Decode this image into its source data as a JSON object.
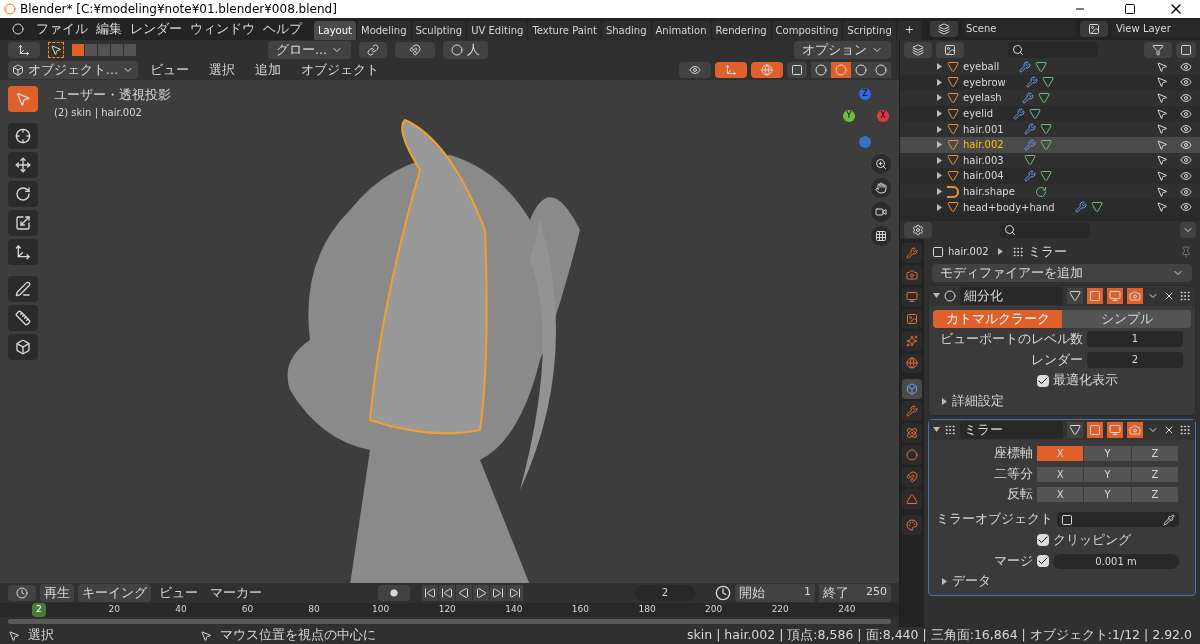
{
  "title_bar": {
    "title": "Blender* [C:¥modeling¥note¥01.blender¥008.blend]"
  },
  "menu": [
    "ファイル",
    "編集",
    "レンダー",
    "ウィンドウ",
    "ヘルプ"
  ],
  "workspaces": [
    {
      "label": "Layout",
      "selected": true
    },
    {
      "label": "Modeling",
      "selected": false
    },
    {
      "label": "Sculpting",
      "selected": false
    },
    {
      "label": "UV Editing",
      "selected": false
    },
    {
      "label": "Texture Paint",
      "selected": false
    },
    {
      "label": "Shading",
      "selected": false
    },
    {
      "label": "Animation",
      "selected": false
    },
    {
      "label": "Rendering",
      "selected": false
    },
    {
      "label": "Compositing",
      "selected": false
    },
    {
      "label": "Scripting",
      "selected": false
    }
  ],
  "add_workspace": "+",
  "scene": "Scene",
  "view_layer": "View Layer",
  "viewport": {
    "select_modes": [
      {
        "selected": true
      },
      {
        "selected": false
      },
      {
        "selected": false
      },
      {
        "selected": false
      },
      {
        "selected": false
      }
    ],
    "transform_orientation": "グロー...",
    "pivot_label": "人",
    "options": "オプション",
    "mode": "オブジェクト...",
    "menus": [
      "ビュー",
      "選択",
      "追加",
      "オブジェクト"
    ],
    "gizmo_on": true,
    "overlays_on": true,
    "shading": [
      {
        "selected": false
      },
      {
        "selected": true
      },
      {
        "selected": false
      },
      {
        "selected": false
      }
    ],
    "view_label": "ユーザー・透視投影",
    "object_label": "(2) skin | hair.002",
    "tools": [
      {
        "selected": true
      },
      {
        "selected": false
      },
      {
        "selected": false
      },
      {
        "selected": false
      },
      {
        "selected": false
      },
      {
        "selected": false
      },
      {
        "selected": false
      },
      {
        "selected": false
      },
      {
        "selected": false
      }
    ],
    "gizmo": {
      "x": "X",
      "y": "Y",
      "z": "Z"
    }
  },
  "outliner": {
    "rows": [
      {
        "name": "eyeball",
        "kind": "mesh",
        "modifier": true,
        "selected": false
      },
      {
        "name": "eyebrow",
        "kind": "mesh",
        "modifier": true,
        "selected": false
      },
      {
        "name": "eyelash",
        "kind": "mesh",
        "modifier": true,
        "selected": false
      },
      {
        "name": "eyelid",
        "kind": "mesh",
        "modifier": true,
        "selected": false
      },
      {
        "name": "hair.001",
        "kind": "mesh",
        "modifier": true,
        "selected": false
      },
      {
        "name": "hair.002",
        "kind": "mesh",
        "modifier": true,
        "selected": true
      },
      {
        "name": "hair.003",
        "kind": "mesh",
        "modifier": false,
        "selected": false
      },
      {
        "name": "hair.004",
        "kind": "mesh",
        "modifier": true,
        "selected": false
      },
      {
        "name": "hair.shape",
        "kind": "curve",
        "modifier": false,
        "selected": false
      },
      {
        "name": "head+body+hand",
        "kind": "mesh",
        "modifier": true,
        "selected": false
      }
    ]
  },
  "properties": {
    "tabs": [
      {
        "selected": false
      },
      {
        "selected": false
      },
      {
        "selected": false
      },
      {
        "selected": false
      },
      {
        "selected": false
      },
      {
        "selected": false
      },
      {
        "selected": true
      },
      {
        "selected": false
      },
      {
        "selected": false
      },
      {
        "selected": false
      },
      {
        "selected": false
      },
      {
        "selected": false
      },
      {
        "selected": false
      }
    ],
    "breadcrumb": {
      "object": "hair.002",
      "modifier": "ミラー"
    },
    "add_modifier": "モディファイアーを追加",
    "modifiers": [
      {
        "kind": "subsurf",
        "name": "細分化",
        "expanded": true,
        "active": false,
        "methods": [
          {
            "label": "カトマルクラーク",
            "selected": true
          },
          {
            "label": "シンプル",
            "selected": false
          }
        ],
        "fields": [
          {
            "label": "ビューポートのレベル数",
            "value": "1"
          },
          {
            "label": "レンダー",
            "value": "2"
          }
        ],
        "checkbox": {
          "label": "最適化表示",
          "checked": true
        },
        "subsection": {
          "label": "詳細設定",
          "expanded": false
        }
      },
      {
        "kind": "mirror",
        "name": "ミラー",
        "expanded": true,
        "active": true,
        "axis_rows": [
          {
            "label": "座標軸",
            "buttons": [
              {
                "label": "X",
                "selected": true
              },
              {
                "label": "Y",
                "selected": false
              },
              {
                "label": "Z",
                "selected": false
              }
            ]
          },
          {
            "label": "二等分",
            "buttons": [
              {
                "label": "X",
                "selected": false
              },
              {
                "label": "Y",
                "selected": false
              },
              {
                "label": "Z",
                "selected": false
              }
            ]
          },
          {
            "label": "反転",
            "buttons": [
              {
                "label": "X",
                "selected": false
              },
              {
                "label": "Y",
                "selected": false
              },
              {
                "label": "Z",
                "selected": false
              }
            ]
          }
        ],
        "mirror_object_label": "ミラーオブジェクト",
        "clipping": {
          "label": "クリッピング",
          "checked": true
        },
        "merge": {
          "label": "マージ",
          "checked": true,
          "value": "0.001 m"
        },
        "subsection": {
          "label": "データ",
          "expanded": false
        }
      }
    ]
  },
  "timeline": {
    "menus": [
      "再生",
      "キーイング",
      "ビュー",
      "マーカー"
    ],
    "current_frame": "2",
    "start_label": "開始",
    "start": "1",
    "end_label": "終了",
    "end": "250",
    "ruler": [
      "20",
      "40",
      "60",
      "80",
      "100",
      "120",
      "140",
      "160",
      "180",
      "200",
      "220",
      "240"
    ],
    "marker": "2"
  },
  "status_bar": {
    "left": "選択",
    "middle": "マウス位置を視点の中心に",
    "right": "skin | hair.002 | 頂点:8,586 | 面:8,440 | 三角面:16,864 | オブジェクト:1/12 | 2.92.0"
  }
}
